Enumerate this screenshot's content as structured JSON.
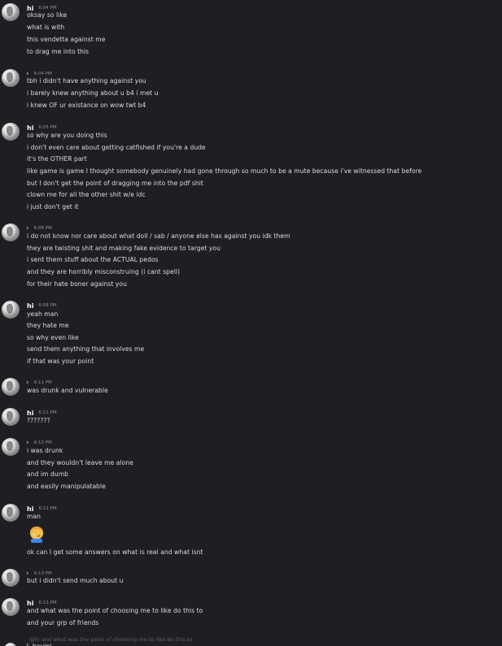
{
  "messages": [
    {
      "user": "hi",
      "time": "6:04 PM",
      "lines": [
        "oksay so like",
        "what is with",
        "this vendetta against me",
        "to drag me into this"
      ]
    },
    {
      "user": "",
      "time": "6:04 PM",
      "lines": [
        "tbh i didn't have anything against you",
        "i barely knew anything about u b4 i met u",
        "i knew OF ur existance on wow twt b4"
      ]
    },
    {
      "user": "hi",
      "time": "6:05 PM",
      "lines": [
        "so why are you doing this",
        "i don't even care about getting catfished if you're a dude",
        "it's the OTHER part",
        "like game is game I thought somebody genuinely had gone through so much to be a mute because i've witnessed that before",
        "but I don't get the point of dragging me into the pdf shit",
        "clown me for all the other shit w/e idc",
        "i just don't get it"
      ]
    },
    {
      "user": "",
      "time": "6:08 PM",
      "lines": [
        "i do not know nor care about what doll / sab / anyone else has against you idk them",
        "they are twisting shit and making fake evidence to target you",
        "i sent them stuff about the ACTUAL pedos",
        "and they are horribly misconstruing (i cant spell)",
        "for their hate boner against you"
      ]
    },
    {
      "user": "hi",
      "time": "6:08 PM",
      "lines": [
        "yeah man",
        "they hate me",
        "so why even like",
        "send them anything that involves me",
        "if that was your point"
      ]
    },
    {
      "user": "",
      "time": "6:11 PM",
      "lines": [
        "was drunk and vulnerable"
      ]
    },
    {
      "user": "hi",
      "time": "6:11 PM",
      "lines": [
        "???????"
      ]
    },
    {
      "user": "",
      "time": "6:12 PM",
      "lines": [
        "i was drunk",
        "and they wouldn't leave me alone",
        "and im dumb",
        "and easily manipulatable"
      ]
    },
    {
      "user": "hi",
      "time": "6:12 PM",
      "lines": [
        "man",
        "ok can I get some answers on what is real and what isnt"
      ]
    },
    {
      "user": "",
      "time": "6:13 PM",
      "lines": [
        "but i didn't send much about u"
      ]
    },
    {
      "user": "hi",
      "time": "6:13 PM",
      "lines": [
        "and what was the point of choosing me to like do this to",
        "and your grp of friends"
      ]
    }
  ],
  "reply_preview": "@hi and what was the point of choosing me to like do this to",
  "last_user": "kayini",
  "emoji": "face-palm-emoji"
}
